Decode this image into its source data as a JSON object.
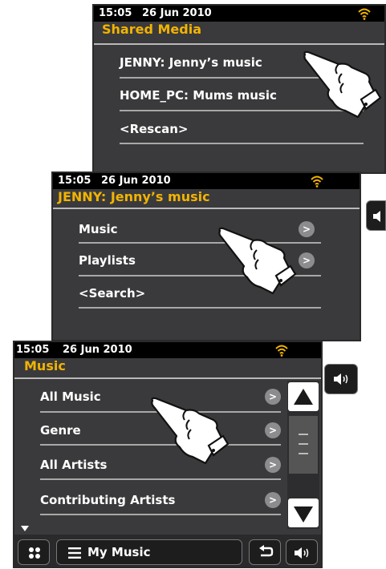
{
  "status": {
    "time": "15:05",
    "date": "26 Jun 2010"
  },
  "screen1": {
    "title": "Shared Media",
    "items": [
      {
        "label": "JENNY: Jenny’s music"
      },
      {
        "label": "HOME_PC: Mums music"
      },
      {
        "label": "<Rescan>"
      }
    ]
  },
  "screen2": {
    "title": "JENNY: Jenny’s music",
    "items": [
      {
        "label": "Music",
        "arrow": ">"
      },
      {
        "label": "Playlists",
        "arrow": ">"
      },
      {
        "label": "<Search>"
      }
    ]
  },
  "screen3": {
    "title": "Music",
    "items": [
      {
        "label": "All Music",
        "arrow": ">"
      },
      {
        "label": "Genre",
        "arrow": ">"
      },
      {
        "label": "All Artists",
        "arrow": ">"
      },
      {
        "label": "Contributing Artists",
        "arrow": ">"
      }
    ],
    "bottom_bar": {
      "menu_label": "My Music"
    }
  },
  "icons": {
    "wifi": "wifi-icon",
    "volume": "volume-icon",
    "back": "back-icon",
    "home": "home-grid-icon",
    "menu": "menu-lines-icon",
    "scroll_up": "scroll-up-icon",
    "scroll_down": "scroll-down-icon",
    "pointer": "pointing-hand-icon"
  },
  "colors": {
    "title": "#f2b400",
    "screen_bg": "#3a3a3c",
    "status_bg": "#000000",
    "wifi": "#f2b400"
  }
}
